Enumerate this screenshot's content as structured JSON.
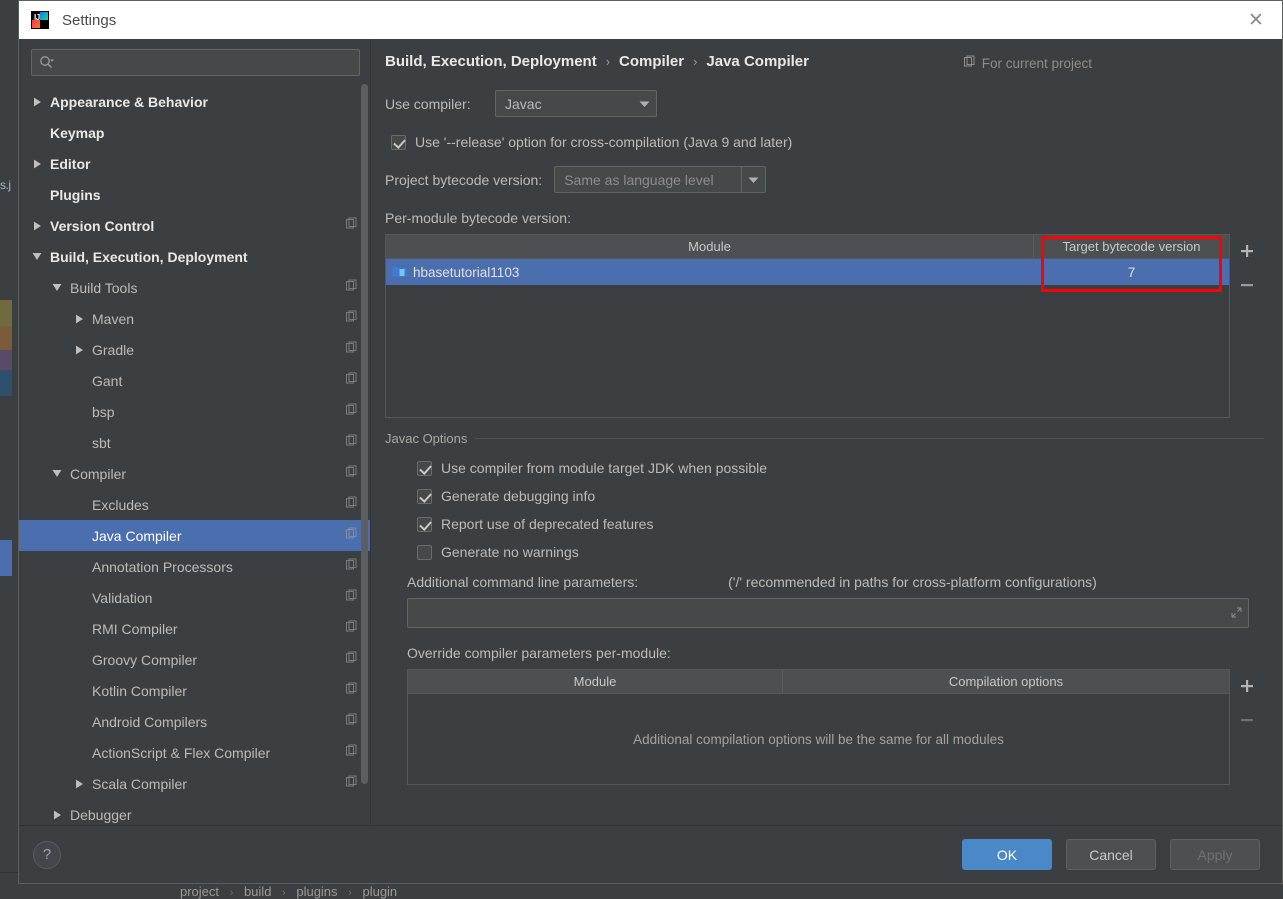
{
  "window": {
    "title": "Settings",
    "app_icon": "intellij-idea-logo",
    "close_icon": "close-icon"
  },
  "search": {
    "value": "",
    "placeholder": "",
    "icon": "search-icon"
  },
  "sidebar": {
    "items": [
      {
        "label": "Appearance & Behavior",
        "level": 0,
        "arrow": "collapsed",
        "badge": false,
        "selected": false
      },
      {
        "label": "Keymap",
        "level": 0,
        "arrow": "none",
        "badge": false,
        "selected": false
      },
      {
        "label": "Editor",
        "level": 0,
        "arrow": "collapsed",
        "badge": false,
        "selected": false
      },
      {
        "label": "Plugins",
        "level": 0,
        "arrow": "none",
        "badge": false,
        "selected": false
      },
      {
        "label": "Version Control",
        "level": 0,
        "arrow": "collapsed",
        "badge": true,
        "selected": false
      },
      {
        "label": "Build, Execution, Deployment",
        "level": 0,
        "arrow": "expanded",
        "badge": false,
        "selected": false
      },
      {
        "label": "Build Tools",
        "level": 1,
        "arrow": "expanded",
        "badge": true,
        "selected": false
      },
      {
        "label": "Maven",
        "level": 2,
        "arrow": "collapsed",
        "badge": true,
        "selected": false
      },
      {
        "label": "Gradle",
        "level": 2,
        "arrow": "collapsed",
        "badge": true,
        "selected": false
      },
      {
        "label": "Gant",
        "level": 2,
        "arrow": "none",
        "badge": true,
        "selected": false
      },
      {
        "label": "bsp",
        "level": 2,
        "arrow": "none",
        "badge": true,
        "selected": false
      },
      {
        "label": "sbt",
        "level": 2,
        "arrow": "none",
        "badge": true,
        "selected": false
      },
      {
        "label": "Compiler",
        "level": 1,
        "arrow": "expanded",
        "badge": true,
        "selected": false
      },
      {
        "label": "Excludes",
        "level": 2,
        "arrow": "none",
        "badge": true,
        "selected": false
      },
      {
        "label": "Java Compiler",
        "level": 2,
        "arrow": "none",
        "badge": true,
        "selected": true
      },
      {
        "label": "Annotation Processors",
        "level": 2,
        "arrow": "none",
        "badge": true,
        "selected": false
      },
      {
        "label": "Validation",
        "level": 2,
        "arrow": "none",
        "badge": true,
        "selected": false
      },
      {
        "label": "RMI Compiler",
        "level": 2,
        "arrow": "none",
        "badge": true,
        "selected": false
      },
      {
        "label": "Groovy Compiler",
        "level": 2,
        "arrow": "none",
        "badge": true,
        "selected": false
      },
      {
        "label": "Kotlin Compiler",
        "level": 2,
        "arrow": "none",
        "badge": true,
        "selected": false
      },
      {
        "label": "Android Compilers",
        "level": 2,
        "arrow": "none",
        "badge": true,
        "selected": false
      },
      {
        "label": "ActionScript & Flex Compiler",
        "level": 2,
        "arrow": "none",
        "badge": true,
        "selected": false
      },
      {
        "label": "Scala Compiler",
        "level": 2,
        "arrow": "collapsed",
        "badge": true,
        "selected": false
      },
      {
        "label": "Debugger",
        "level": 1,
        "arrow": "collapsed",
        "badge": false,
        "selected": false
      }
    ]
  },
  "header": {
    "breadcrumb": [
      "Build, Execution, Deployment",
      "Compiler",
      "Java Compiler"
    ],
    "separator": "›",
    "scope_label": "For current project",
    "scope_icon": "project-scope-icon"
  },
  "main": {
    "use_compiler_label": "Use compiler:",
    "use_compiler_value": "Javac",
    "release_option": {
      "label": "Use '--release' option for cross-compilation (Java 9 and later)",
      "checked": true
    },
    "project_bytecode_label": "Project bytecode version:",
    "project_bytecode_value": "Same as language level",
    "per_module_label": "Per-module bytecode version:",
    "module_table": {
      "columns": [
        "Module",
        "Target bytecode version"
      ],
      "rows": [
        {
          "module": "hbasetutorial1103",
          "target": "7",
          "selected": true,
          "icon": "module-icon"
        }
      ],
      "add_button": "+",
      "remove_button": "−"
    },
    "javac_options": {
      "title": "Javac Options",
      "checkboxes": [
        {
          "label": "Use compiler from module target JDK when possible",
          "checked": true
        },
        {
          "label": "Generate debugging info",
          "checked": true
        },
        {
          "label": "Report use of deprecated features",
          "checked": true
        },
        {
          "label": "Generate no warnings",
          "checked": false
        }
      ],
      "additional_params_label": "Additional command line parameters:",
      "additional_params_hint": "('/' recommended in paths for cross-platform configurations)",
      "additional_params_value": "",
      "expand_icon": "expand-icon",
      "override_label": "Override compiler parameters per-module:",
      "override_table": {
        "columns": [
          "Module",
          "Compilation options"
        ],
        "empty_message": "Additional compilation options will be the same for all modules",
        "add_button": "+",
        "remove_button": "−"
      }
    }
  },
  "footer": {
    "help_label": "?",
    "ok_label": "OK",
    "cancel_label": "Cancel",
    "apply_label": "Apply"
  },
  "background": {
    "breadcrumb": [
      "project",
      "build",
      "plugins",
      "plugin"
    ],
    "separator": "›",
    "gutter_text": "s.j"
  },
  "annotation": {
    "color": "#ff0000",
    "target": "target-bytecode-version-cell"
  }
}
